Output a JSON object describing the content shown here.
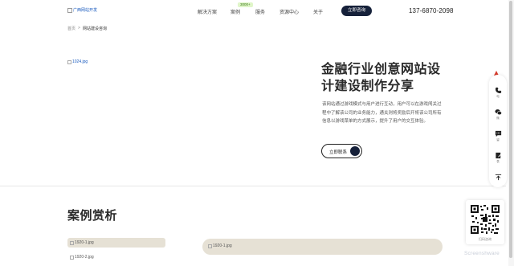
{
  "header": {
    "logo_text": "广西网站开发",
    "nav": [
      {
        "label": "解决方案"
      },
      {
        "label": "案例",
        "badge": "3000+"
      },
      {
        "label": "服务"
      },
      {
        "label": "资源中心"
      },
      {
        "label": "关于"
      }
    ],
    "cta_label": "立即咨询",
    "phone": "137-6870-2098"
  },
  "breadcrumb": {
    "home": "首页",
    "sep": ">",
    "current": "网站建设咨询"
  },
  "hero": {
    "image_alt": "1024.jpg",
    "title": "金融行业创意网站设计建设制作分享",
    "description": "该网站通过游戏模式与用户进行互动，用户可以在游戏闯关过程中了解该公司的业务能力，通关则将奖励后开将该公司所有信息以游戏菜单的方式展示，提升了用户的交互体验。",
    "button_label": "立即联系"
  },
  "cases": {
    "title": "案例赏析",
    "items": [
      {
        "alt": "1920-1.jpg"
      },
      {
        "alt": "1920-2.jpg"
      },
      {
        "alt": "1920-1.jpg"
      }
    ]
  },
  "sidebar": {
    "items": [
      {
        "icon": "phone-icon",
        "label": "电"
      },
      {
        "icon": "wechat-icon",
        "label": "微"
      },
      {
        "icon": "message-icon",
        "label": "留"
      },
      {
        "icon": "form-icon",
        "label": "表"
      },
      {
        "icon": "back-to-top-icon",
        "label": ""
      }
    ]
  },
  "qr": {
    "caption": "扫码咨询"
  },
  "watermark": "Screenshware",
  "colors": {
    "primary_dark": "#16213a",
    "card_beige": "#e6e1d5",
    "badge_green": "#dff5c8",
    "flag_red": "#d83b2b"
  }
}
